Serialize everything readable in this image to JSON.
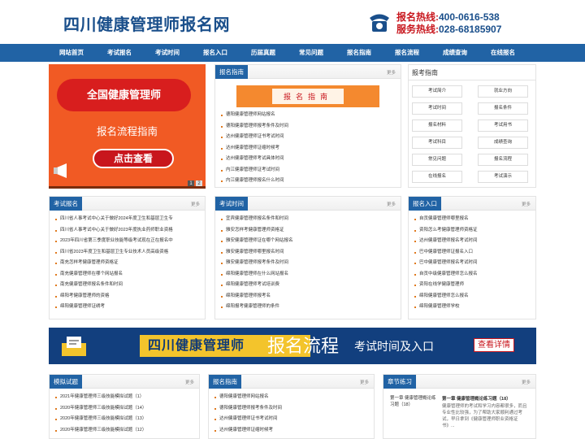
{
  "header": {
    "site_title": "四川健康管理师报名网",
    "hotline1_label": "报名热线:",
    "hotline1_number": "400-0616-538",
    "hotline2_label": "服务热线:",
    "hotline2_number": "028-68185907"
  },
  "nav": [
    "网站首页",
    "考试报名",
    "考试时间",
    "报名入口",
    "历届真题",
    "常见问题",
    "报名指南",
    "报名流程",
    "成绩查询",
    "在线报名"
  ],
  "banner": {
    "bubble": "全国健康管理师",
    "subtitle": "报名流程指南",
    "button": "点击查看",
    "dots": [
      "1",
      "2"
    ]
  },
  "guide_panel": {
    "title": "报名指南",
    "more": "更多",
    "image_text": "报名指南",
    "items": [
      "德阳健康管理师网站报名",
      "德阳健康管理师报考条件及时间",
      "达州健康管理师证书考试时间",
      "达州健康管理师证缩时候考",
      "达州健康管理师考试具体时间",
      "内江健康管理师证考试时间",
      "内江健康管理师报名什么时间"
    ]
  },
  "exam_box": {
    "title": "报考指南",
    "buttons": [
      "考试简介",
      "就业方向",
      "考试时间",
      "报名条件",
      "报名材料",
      "考试用书",
      "考试科目",
      "成绩查询",
      "常见问题",
      "报名流程",
      "在线报名",
      "考试演示"
    ]
  },
  "exam_reg": {
    "title": "考试报名",
    "more": "更多",
    "items": [
      "四川省人事考试中心关于做好2024年度卫生和基层卫生专",
      "四川省人事考试中心关于做好2023年度执业药师职业资格",
      "2023年四川省第三季度职业技能等级考试现在正在报名中",
      "四川省2023年度卫生和基层卫生专业技术人员高级资格",
      "南充怎样考健康管理师资格证",
      "南充健康管理师在哪个网站报名",
      "南充健康管理师报名条件和时间",
      "绵阳考健康管理师的资格",
      "绵阳健康管理师证绣考"
    ]
  },
  "exam_time": {
    "title": "考试时间",
    "more": "更多",
    "items": [
      "宜宾健康管理师报名条件和时间",
      "雅安怎样考健康管理师资格证",
      "雅安健康管理师证在哪个网站报名",
      "雅安健康管理师哪里报名时间",
      "雅安健康管理师报考条件及时间",
      "绵阳健康管理师在什么网站报名",
      "绵阳健康管理师考试培训费",
      "绵阳健康管理师报考名",
      "绵阳报考健康管理师的条件"
    ]
  },
  "reg_entry": {
    "title": "报名入口",
    "more": "更多",
    "items": [
      "自贡健康管理师哪里报名",
      "资阳怎么考健康管理师资格证",
      "达州健康管理师报名考试时间",
      "巴中健康管理师证报名入口",
      "巴中健康管理师报名考试时间",
      "自贡中级健康管理师怎么报名",
      "资阳在线学健康管理师",
      "绵阳健康管理师怎么报名",
      "绵阳健康管理师学校"
    ]
  },
  "blue_banner": {
    "tag": "四川健康管理师",
    "big": "报名流程",
    "small": "考试时间及入口",
    "cta": "查看详情"
  },
  "mock_exam": {
    "title": "模拟试题",
    "more": "更多",
    "items": [
      "2021年健康管理师三级技能模拟试题（1）",
      "2020年健康管理师三级技能模拟试题（14）",
      "2020年健康管理师三级技能模拟试题（13）",
      "2020年健康管理师三级技能模拟试题（12）"
    ]
  },
  "guide_panel2": {
    "title": "报名指南",
    "more": "更多",
    "items": [
      "德阳健康管理师网站报名",
      "德阳健康管理师报考条件及时间",
      "达州健康管理师证书考试时间",
      "达州健康管理师证缩时候考"
    ]
  },
  "chapter": {
    "title": "章节练习",
    "more": "更多",
    "image_alt": "第一章 健康管理概论练习题（18）",
    "heading": "第一章 健康管理概论练习题（18）",
    "desc": "健康管理师的考试和学习内容都很多，而且专业性比较强，为了帮助大家顺利通过考试，早日拿到《健康管理师职业资格证书》..."
  }
}
